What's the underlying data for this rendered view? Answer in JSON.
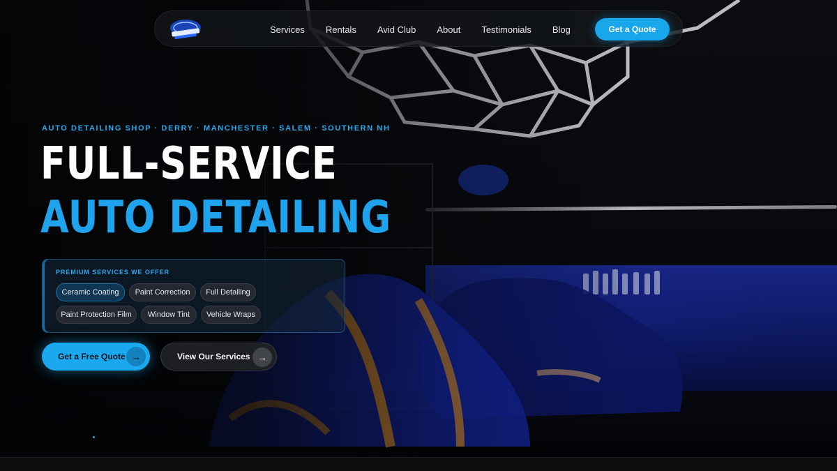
{
  "nav": {
    "links": [
      "Services",
      "Rentals",
      "Avid Club",
      "About",
      "Testimonials",
      "Blog"
    ],
    "cta_label": "Get a Quote"
  },
  "hero": {
    "eyebrow": "AUTO DETAILING SHOP · DERRY · MANCHESTER · SALEM · SOUTHERN NH",
    "headline_line1": "FULL-SERVICE",
    "headline_line2": "AUTO DETAILING",
    "services_title": "PREMIUM SERVICES WE OFFER",
    "services": [
      "Ceramic Coating",
      "Paint Correction",
      "Full Detailing",
      "Paint Protection Film",
      "Window Tint",
      "Vehicle Wraps"
    ],
    "active_service": "Ceramic Coating",
    "primary_button": "Get a Free Quote",
    "secondary_button": "View Our Services",
    "arrow_icon": "→"
  },
  "colors": {
    "accent": "#1aa8ef",
    "background": "#050608",
    "garage_blue": "#1a2a9a"
  }
}
